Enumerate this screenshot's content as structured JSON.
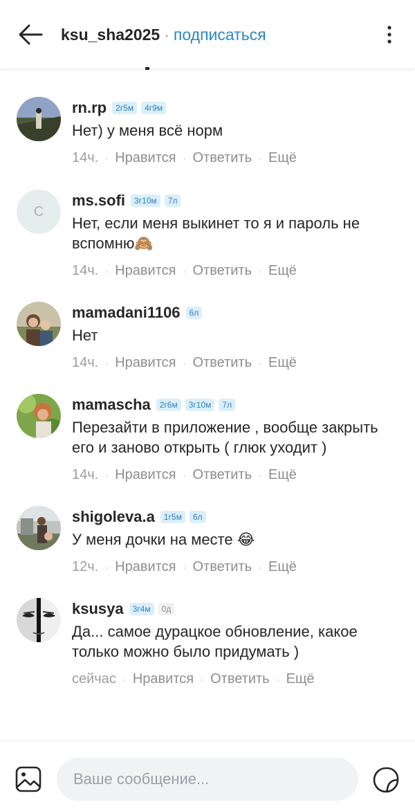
{
  "header": {
    "back_icon": "arrow-left-icon",
    "username": "ksu_sha2025",
    "separator": "·",
    "subscribe_label": "подписаться",
    "menu_icon": "more-vertical-icon"
  },
  "actions": {
    "like": "Нравится",
    "reply": "Ответить",
    "more": "Ещё",
    "separator": "·"
  },
  "comments": [
    {
      "username": "rn.rp",
      "badges": [
        "2г5м",
        "4г9м"
      ],
      "text": "Нет) у меня всё норм",
      "time": "14ч."
    },
    {
      "username": "ms.sofi",
      "avatar_letter": "С",
      "badges": [
        "3г10м",
        "7л"
      ],
      "text": "Нет, если меня выкинет то я и пароль не вспомню🙈",
      "time": "14ч."
    },
    {
      "username": "mamadani1106",
      "badges": [
        "6л"
      ],
      "text": "Нет",
      "time": "14ч."
    },
    {
      "username": "mamascha",
      "badges": [
        "2г6м",
        "3г10м",
        "7л"
      ],
      "text": "Перезайти в приложение , вообще закрыть его и заново открыть ( глюк уходит )",
      "time": "14ч."
    },
    {
      "username": "shigoleva.a",
      "badges": [
        "1г5м",
        "6л"
      ],
      "text": "У меня дочки на месте 😂",
      "time": "12ч."
    },
    {
      "username": "ksusya",
      "badges": [
        "3г4м",
        "0д"
      ],
      "text": "Да... самое дурацкое обновление, какое только можно было придумать )",
      "time": "сейчас"
    }
  ],
  "composer": {
    "gallery_icon": "image-icon",
    "placeholder": "Ваше сообщение...",
    "sticker_icon": "sticker-icon"
  },
  "colors": {
    "accent": "#2a86c7",
    "badge_bg": "#dbeffa",
    "badge_text": "#2f7fc1",
    "meta_text": "#9e9e9e"
  }
}
